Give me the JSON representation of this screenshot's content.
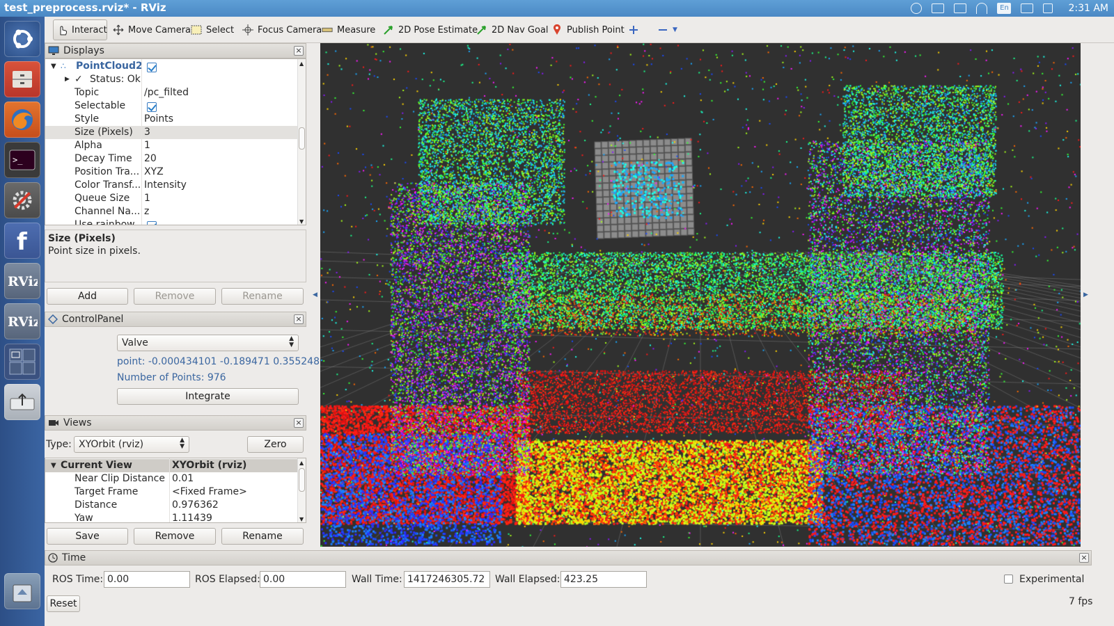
{
  "window": {
    "title": "test_preprocess.rviz* - RViz"
  },
  "system_tray": {
    "language": "En",
    "clock": "2:31 AM"
  },
  "toolbar": {
    "tools": [
      {
        "label": "Interact",
        "icon": "hand-cursor-icon",
        "active": true
      },
      {
        "label": "Move Camera",
        "icon": "move-camera-icon"
      },
      {
        "label": "Select",
        "icon": "select-box-icon"
      },
      {
        "label": "Focus Camera",
        "icon": "focus-camera-icon"
      },
      {
        "label": "Measure",
        "icon": "ruler-icon"
      },
      {
        "label": "2D Pose Estimate",
        "icon": "pose-arrow-icon"
      },
      {
        "label": "2D Nav Goal",
        "icon": "nav-goal-arrow-icon"
      },
      {
        "label": "Publish Point",
        "icon": "map-pin-icon"
      }
    ]
  },
  "displays": {
    "title": "Displays",
    "plugin": {
      "name": "PointCloud2",
      "status": "Status: Ok"
    },
    "properties": [
      {
        "key": "Topic",
        "value": "/pc_filted"
      },
      {
        "key": "Selectable",
        "value": "",
        "checkbox": true
      },
      {
        "key": "Style",
        "value": "Points"
      },
      {
        "key": "Size (Pixels)",
        "value": "3"
      },
      {
        "key": "Alpha",
        "value": "1"
      },
      {
        "key": "Decay Time",
        "value": "20"
      },
      {
        "key": "Position Tra...",
        "value": "XYZ"
      },
      {
        "key": "Color Transf...",
        "value": "Intensity"
      },
      {
        "key": "Queue Size",
        "value": "1"
      },
      {
        "key": "Channel Na...",
        "value": "z"
      },
      {
        "key": "Use rainbow",
        "value": "",
        "checkbox": true
      }
    ],
    "help": {
      "title": "Size (Pixels)",
      "text": "Point size in pixels."
    },
    "buttons": {
      "add": "Add",
      "remove": "Remove",
      "rename": "Rename"
    }
  },
  "control_panel": {
    "title": "ControlPanel",
    "selected": "Valve",
    "point": "point: -0.000434101 -0.189471 0.355248",
    "num_points": "Number of Points: 976",
    "integrate": "Integrate"
  },
  "views": {
    "title": "Views",
    "type_label": "Type:",
    "type_value": "XYOrbit (rviz)",
    "zero": "Zero",
    "header": {
      "key": "Current View",
      "value": "XYOrbit (rviz)"
    },
    "properties": [
      {
        "key": "Near Clip Distance",
        "value": "0.01"
      },
      {
        "key": "Target Frame",
        "value": "<Fixed Frame>"
      },
      {
        "key": "Distance",
        "value": "0.976362"
      },
      {
        "key": "Yaw",
        "value": "1.11439"
      }
    ],
    "buttons": {
      "save": "Save",
      "remove": "Remove",
      "rename": "Rename"
    }
  },
  "time": {
    "title": "Time",
    "ros_time_label": "ROS Time:",
    "ros_time": "0.00",
    "ros_elapsed_label": "ROS Elapsed:",
    "ros_elapsed": "0.00",
    "wall_time_label": "Wall Time:",
    "wall_time": "1417246305.72",
    "wall_elapsed_label": "Wall Elapsed:",
    "wall_elapsed": "423.25",
    "experimental": "Experimental",
    "reset": "Reset",
    "fps": "7 fps"
  },
  "colors": {
    "viewport_bg": "#303030",
    "launcher": "#3b65a3",
    "titlebar": "#5f9fd6"
  }
}
